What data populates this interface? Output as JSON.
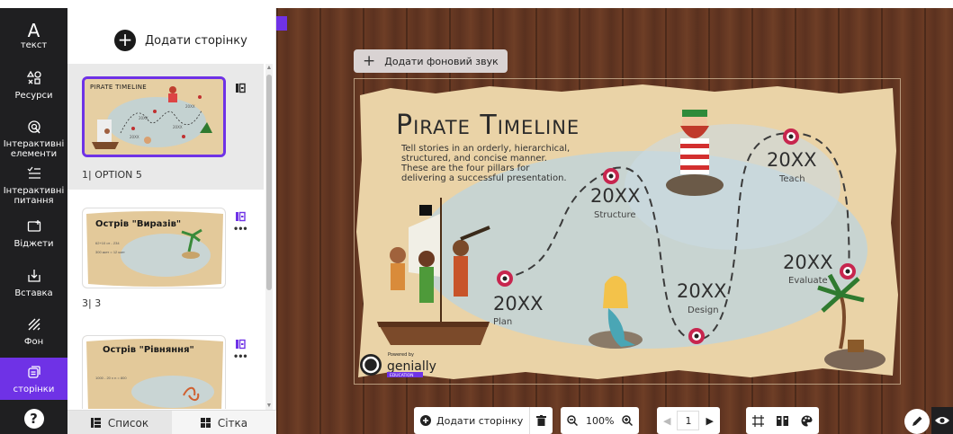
{
  "toolbar": {
    "items": [
      {
        "label": "текст",
        "icon": "text-icon"
      },
      {
        "label": "Ресурси",
        "icon": "resources-icon"
      },
      {
        "label": "Інтерактивні елементи",
        "icon": "interactive-elements-icon"
      },
      {
        "label": "Інтерактивні питання",
        "icon": "interactive-questions-icon"
      },
      {
        "label": "Віджети",
        "icon": "widgets-icon"
      },
      {
        "label": "Вставка",
        "icon": "insert-icon"
      },
      {
        "label": "Фон",
        "icon": "background-icon"
      },
      {
        "label": "сторінки",
        "icon": "pages-icon"
      }
    ],
    "help": "?",
    "accent_color": "#6f32e6"
  },
  "pages_panel": {
    "add_page_label": "Додати сторінку",
    "pages": [
      {
        "thumb_title": "Pirate Timeline",
        "label": "1| OPTION 5"
      },
      {
        "thumb_title": "Острів \"Виразів\"",
        "thumb_lines": [
          "62+10 от - 234",
          "300 ккет = 12 ккет"
        ],
        "label": "3| 3"
      },
      {
        "thumb_title": "Острів \"Рівняння\"",
        "thumb_lines": [
          "1000 - 20 x n = 800"
        ],
        "label": ""
      }
    ],
    "view_tabs": {
      "list": "Список",
      "grid": "Сітка"
    }
  },
  "canvas": {
    "add_sound_label": "Додати фоновий звук",
    "slide": {
      "title": "Pirate Timeline",
      "description": "Tell stories in an orderly, hierarchical, structured, and concise manner. These are the four pillars for delivering a successful presentation.",
      "milestones": [
        {
          "year": "20XX",
          "name": "Plan"
        },
        {
          "year": "20XX",
          "name": "Structure"
        },
        {
          "year": "20XX",
          "name": "Design"
        },
        {
          "year": "20XX",
          "name": "Teach"
        },
        {
          "year": "20XX",
          "name": "Evaluate"
        }
      ],
      "logo_text": "genially",
      "logo_small": "Powered by",
      "logo_sub": "EDUCATION"
    }
  },
  "bottom_bar": {
    "add_page_label": "Додати сторінку",
    "zoom": "100%",
    "page_number": "1"
  }
}
